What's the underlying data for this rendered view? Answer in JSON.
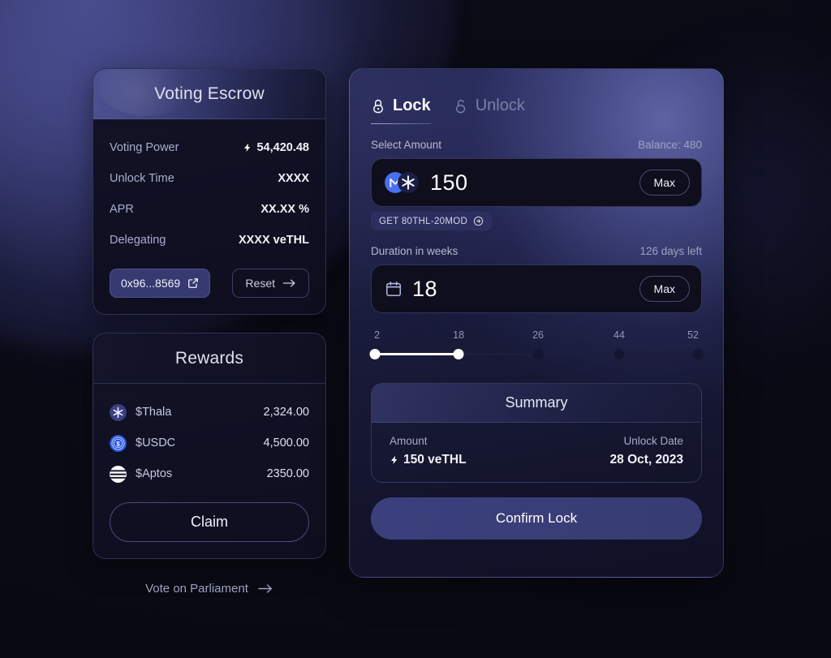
{
  "left": {
    "escrow": {
      "title": "Voting Escrow",
      "rows": [
        {
          "label": "Voting Power",
          "value": "54,420.48",
          "icon": "bolt-icon"
        },
        {
          "label": "Unlock Time",
          "value": "XXXX",
          "icon": ""
        },
        {
          "label": "APR",
          "value": "XX.XX %",
          "icon": ""
        },
        {
          "label": "Delegating",
          "value": "XXXX veTHL",
          "icon": ""
        }
      ],
      "address_button": {
        "label": "0x96...8569",
        "icon": "external-link-icon"
      },
      "reset_button": {
        "label": "Reset",
        "icon": "arrow-right-icon"
      }
    },
    "rewards": {
      "title": "Rewards",
      "items": [
        {
          "name": "$Thala",
          "amount": "2,324.00",
          "icon": "thala-token-icon",
          "color": "#3a3f82"
        },
        {
          "name": "$USDC",
          "amount": "4,500.00",
          "icon": "usdc-token-icon",
          "color": "#2a55e0"
        },
        {
          "name": "$Aptos",
          "amount": "2350.00",
          "icon": "aptos-token-icon",
          "color": "#ffffff"
        }
      ],
      "claim_label": "Claim"
    },
    "vote_link": {
      "label": "Vote on Parliament",
      "icon": "arrow-right-icon"
    }
  },
  "right": {
    "tabs": [
      {
        "label": "Lock",
        "icon": "padlock-closed-icon",
        "active": true
      },
      {
        "label": "Unlock",
        "icon": "padlock-open-icon",
        "active": false
      }
    ],
    "amount": {
      "label": "Select Amount",
      "meta": "Balance: 480",
      "value": "150",
      "max_label": "Max",
      "pair_icons": [
        "mod-token-icon",
        "thala-token-icon"
      ],
      "badge": {
        "label": "GET 80THL-20MOD",
        "icon": "circle-arrow-right-icon"
      }
    },
    "duration": {
      "label": "Duration in weeks",
      "meta": "126 days left",
      "value": "18",
      "max_label": "Max",
      "icon": "calendar-icon"
    },
    "slider": {
      "ticks": [
        {
          "label": "2",
          "pos": 0,
          "filled": true
        },
        {
          "label": "18",
          "pos": 26.5,
          "filled": true
        },
        {
          "label": "26",
          "pos": 50.5,
          "filled": false
        },
        {
          "label": "44",
          "pos": 75,
          "filled": false
        },
        {
          "label": "52",
          "pos": 100,
          "filled": false
        }
      ],
      "fill_percent": 26.5
    },
    "summary": {
      "title": "Summary",
      "amount_label": "Amount",
      "amount_value": "150 veTHL",
      "amount_icon": "bolt-icon",
      "unlock_label": "Unlock Date",
      "unlock_value": "28 Oct, 2023"
    },
    "confirm_label": "Confirm Lock"
  },
  "colors": {
    "accent": "#3b3f7c",
    "panel_highlight": "#6065a8",
    "page_bg": "#0b0b16",
    "text_primary": "#f1f2f8",
    "text_muted": "#a9adc9"
  }
}
